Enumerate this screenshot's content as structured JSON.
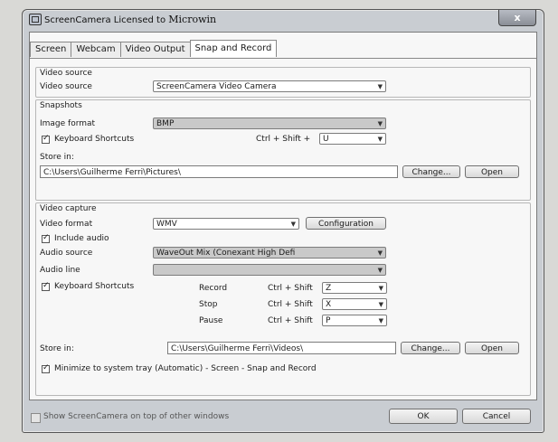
{
  "window": {
    "title": "ScreenCamera Licensed to",
    "owner": "Microwin",
    "close_glyph": "x"
  },
  "tabs": [
    "Screen",
    "Webcam",
    "Video Output",
    "Snap and Record"
  ],
  "active_tab": "Snap and Record",
  "video_source": {
    "group": "Video source",
    "label": "Video source",
    "value": "ScreenCamera Video Camera"
  },
  "snapshots": {
    "group": "Snapshots",
    "image_format_label": "Image format",
    "image_format_value": "BMP",
    "keyboard_shortcuts_label": "Keyboard Shortcuts",
    "keyboard_shortcuts_checked": true,
    "shortcut_combo": "Ctrl + Shift +",
    "shortcut_key": "U",
    "store_in_label": "Store in:",
    "store_path": "C:\\Users\\Guilherme Ferri\\Pictures\\",
    "change_label": "Change...",
    "open_label": "Open"
  },
  "video_capture": {
    "group": "Video capture",
    "video_format_label": "Video format",
    "video_format_value": "WMV",
    "configuration_label": "Configuration",
    "include_audio_label": "Include audio",
    "include_audio_checked": true,
    "audio_source_label": "Audio source",
    "audio_source_value": "WaveOut Mix (Conexant High Defi",
    "audio_line_label": "Audio line",
    "audio_line_value": "",
    "keyboard_shortcuts_label": "Keyboard Shortcuts",
    "keyboard_shortcuts_checked": true,
    "shortcuts": [
      {
        "action": "Record",
        "combo": "Ctrl + Shift",
        "key": "Z"
      },
      {
        "action": "Stop",
        "combo": "Ctrl + Shift",
        "key": "X"
      },
      {
        "action": "Pause",
        "combo": "Ctrl + Shift",
        "key": "P"
      }
    ],
    "store_in_label": "Store in:",
    "store_path": "C:\\Users\\Guilherme Ferri\\Videos\\",
    "change_label": "Change...",
    "open_label": "Open",
    "minimize_label": "Minimize to system tray (Automatic) - Screen - Snap and Record",
    "minimize_checked": true
  },
  "footer": {
    "on_top_label": "Show ScreenCamera on top of other windows",
    "on_top_checked": false,
    "ok_label": "OK",
    "cancel_label": "Cancel"
  }
}
